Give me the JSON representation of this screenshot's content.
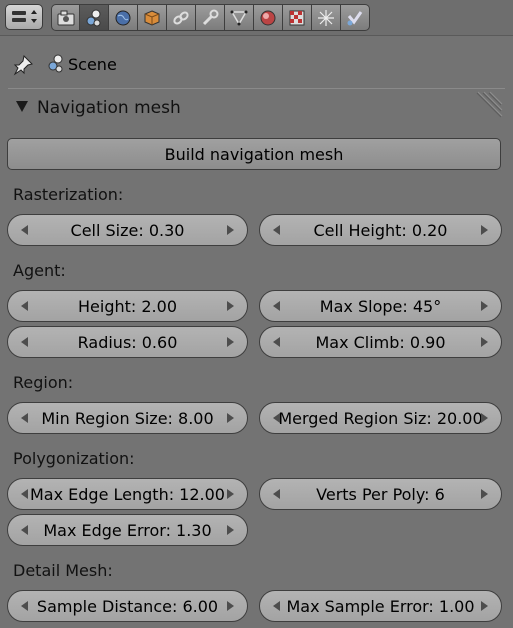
{
  "header": {
    "tabs": [
      {
        "icon": "render-icon"
      },
      {
        "icon": "scene-icon",
        "active": true
      },
      {
        "icon": "world-icon"
      },
      {
        "icon": "object-icon"
      },
      {
        "icon": "constraints-icon"
      },
      {
        "icon": "modifiers-icon"
      },
      {
        "icon": "data-icon"
      },
      {
        "icon": "material-icon"
      },
      {
        "icon": "texture-icon"
      },
      {
        "icon": "particles-icon"
      },
      {
        "icon": "physics-icon"
      }
    ]
  },
  "context": {
    "label": "Scene"
  },
  "panel": {
    "title": "Navigation mesh"
  },
  "build_button": "Build navigation mesh",
  "sections": {
    "rasterization": "Rasterization:",
    "agent": "Agent:",
    "region": "Region:",
    "polygonization": "Polygonization:",
    "detail_mesh": "Detail Mesh:"
  },
  "fields": {
    "cell_size": "Cell Size: 0.30",
    "cell_height": "Cell Height: 0.20",
    "height": "Height: 2.00",
    "max_slope": "Max Slope: 45°",
    "radius": "Radius: 0.60",
    "max_climb": "Max Climb: 0.90",
    "min_region_size": "Min Region Size: 8.00",
    "merged_region_size": "Merged Region Siz: 20.00",
    "max_edge_length": "Max Edge Length: 12.00",
    "verts_per_poly": "Verts Per Poly: 6",
    "max_edge_error": "Max Edge Error: 1.30",
    "sample_distance": "Sample Distance: 6.00",
    "max_sample_error": "Max Sample Error: 1.00"
  }
}
